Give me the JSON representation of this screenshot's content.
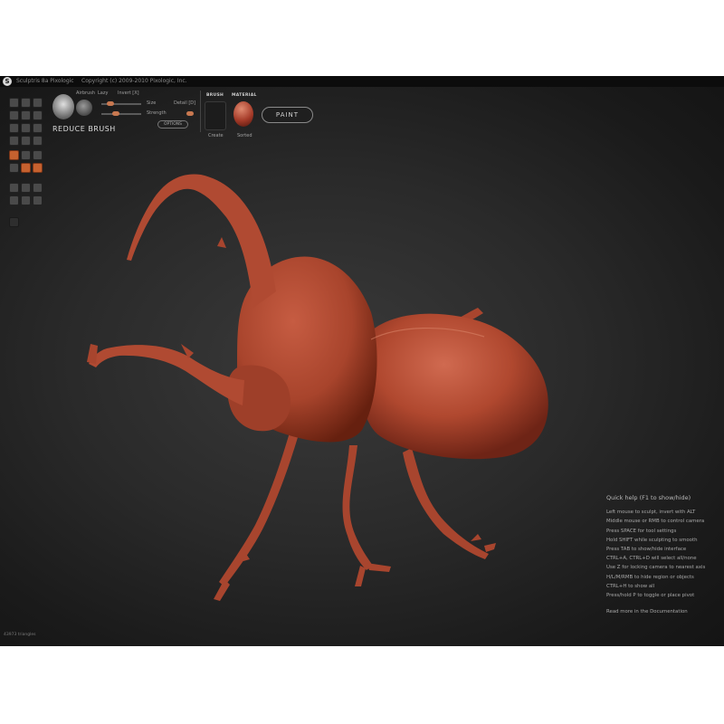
{
  "window": {
    "logo_glyph": "S",
    "title": "Sculptris 8a Pixologic",
    "copyright": "Copyright (c) 2009-2010 Pixologic, Inc."
  },
  "toolbar": {
    "brush_name": "REDUCE BRUSH",
    "airbrush_label": "Airbrush",
    "lazy_label": "Lazy",
    "invert_label": "Invert [X]",
    "size_label": "Size",
    "strength_label": "Strength",
    "detail_label": "Detail [D]",
    "options_label": "OPTIONS",
    "brush_section": "BRUSH",
    "brush_value": "Create",
    "material_section": "MATERIAL",
    "material_value": "Sorted",
    "paint_button": "PAINT"
  },
  "help": {
    "title": "Quick help (F1 to show/hide)",
    "lines": [
      "Left mouse to sculpt, invert with ALT",
      "Middle mouse or RMB to control camera",
      "Press SPACE for tool settings",
      "Hold SHIFT while sculpting to smooth",
      "Press TAB to show/hide interface",
      "CTRL+A, CTRL+D will select all/none",
      "Use Z for locking camera to nearest axis",
      "H/L/M/RMB to hide region or objects",
      "CTRL+H to show all",
      "Press/hold P to toggle or place pivot"
    ],
    "more": "Read more in the Documentation"
  },
  "status": {
    "fps": "43973 triangles"
  },
  "colors": {
    "model": "#b85038",
    "accent_orange": "#c6612f",
    "background": "#2a2a2a"
  }
}
